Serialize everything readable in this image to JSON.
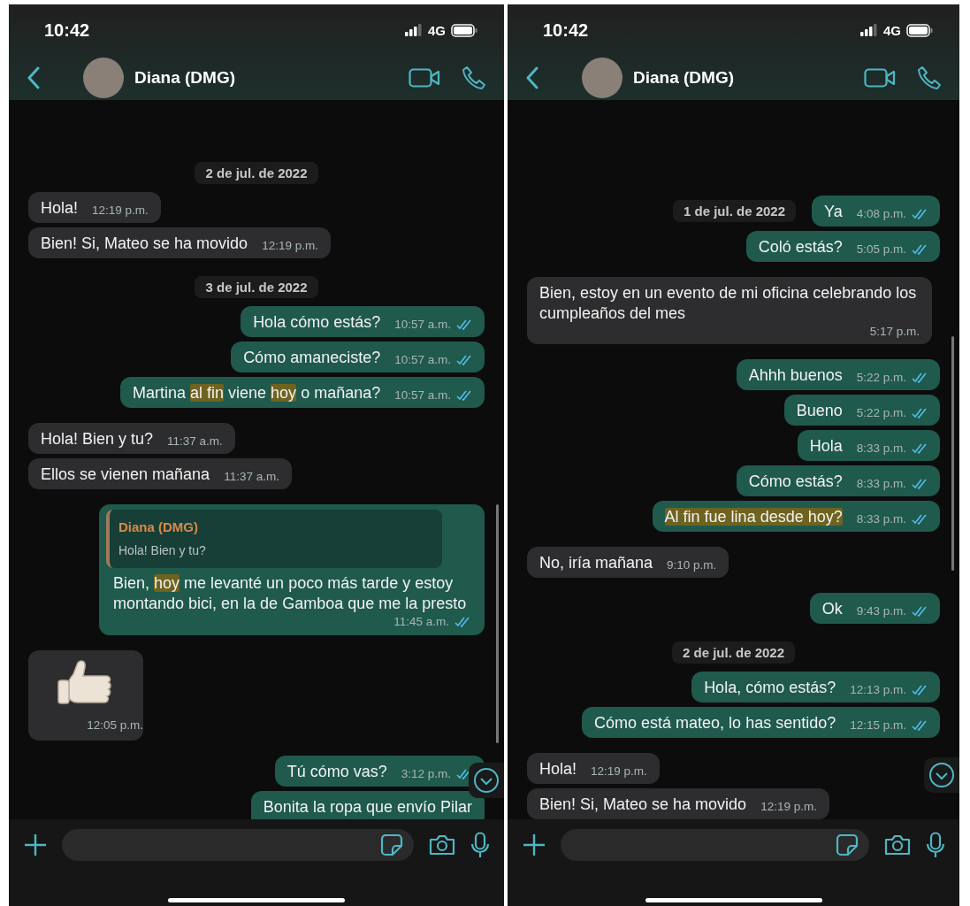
{
  "phones": [
    {
      "status_bar": {
        "time": "10:42",
        "network": "4G"
      },
      "header": {
        "contact": "Diana (DMG)"
      },
      "items": [
        {
          "kind": "date",
          "text": "2 de jul. de 2022"
        },
        {
          "kind": "message",
          "outgoing": false,
          "parts": [
            {
              "text": "Hola!",
              "highlight": false
            }
          ],
          "time": "12:19 p.m."
        },
        {
          "kind": "message",
          "outgoing": false,
          "parts": [
            {
              "text": "Bien! Si, Mateo se ha movido",
              "highlight": false
            }
          ],
          "time": "12:19 p.m."
        },
        {
          "kind": "date",
          "text": "3 de jul. de 2022"
        },
        {
          "kind": "message",
          "outgoing": true,
          "parts": [
            {
              "text": "Hola cómo estás?",
              "highlight": false
            }
          ],
          "time": "10:57 a.m.",
          "read": true
        },
        {
          "kind": "message",
          "outgoing": true,
          "parts": [
            {
              "text": "Cómo amaneciste?",
              "highlight": false
            }
          ],
          "time": "10:57 a.m.",
          "read": true
        },
        {
          "kind": "message",
          "outgoing": true,
          "parts": [
            {
              "text": "Martina ",
              "highlight": false
            },
            {
              "text": "al fin",
              "highlight": true
            },
            {
              "text": " viene ",
              "highlight": false
            },
            {
              "text": "hoy",
              "highlight": true
            },
            {
              "text": " o mañana?",
              "highlight": false
            }
          ],
          "time": "10:57 a.m.",
          "read": true
        },
        {
          "kind": "message",
          "outgoing": false,
          "parts": [
            {
              "text": "Hola! Bien y tu?",
              "highlight": false
            }
          ],
          "time": "11:37 a.m."
        },
        {
          "kind": "message",
          "outgoing": false,
          "parts": [
            {
              "text": "Ellos se vienen mañana",
              "highlight": false
            }
          ],
          "time": "11:37 a.m."
        },
        {
          "kind": "reply",
          "outgoing": true,
          "quote": {
            "author": "Diana (DMG)",
            "text": "Hola! Bien y tu?"
          },
          "parts": [
            {
              "text": "Bien, ",
              "highlight": false
            },
            {
              "text": "hoy",
              "highlight": true
            },
            {
              "text": " me levanté un poco más tarde y estoy montando bici, en la de Gamboa que me la presto",
              "highlight": false
            }
          ],
          "time": "11:45 a.m.",
          "read": true
        },
        {
          "kind": "sticker",
          "outgoing": false,
          "time": "12:05 p.m."
        },
        {
          "kind": "message",
          "outgoing": true,
          "parts": [
            {
              "text": "Tú cómo vas?",
              "highlight": false
            }
          ],
          "time": "3:12 p.m.",
          "read": true
        },
        {
          "kind": "partial",
          "outgoing": true,
          "parts": [
            {
              "text": "Bonita la ropa que envío Pilar",
              "highlight": false
            }
          ]
        }
      ]
    },
    {
      "status_bar": {
        "time": "10:42",
        "network": "4G"
      },
      "header": {
        "contact": "Diana (DMG)"
      },
      "items": [
        {
          "kind": "dated",
          "date": "1 de jul. de 2022",
          "outgoing": true,
          "parts": [
            {
              "text": "Ya",
              "highlight": false
            }
          ],
          "time": "4:08 p.m.",
          "read": true
        },
        {
          "kind": "message",
          "outgoing": true,
          "parts": [
            {
              "text": "Coló estás?",
              "highlight": false
            }
          ],
          "time": "5:05 p.m.",
          "read": true
        },
        {
          "kind": "message",
          "outgoing": false,
          "parts": [
            {
              "text": "Bien, estoy en un evento de mi oficina celebrando los cumpleaños del mes",
              "highlight": false
            }
          ],
          "time": "5:17 p.m."
        },
        {
          "kind": "message",
          "outgoing": true,
          "parts": [
            {
              "text": "Ahhh buenos",
              "highlight": false
            }
          ],
          "time": "5:22 p.m.",
          "read": true
        },
        {
          "kind": "message",
          "outgoing": true,
          "parts": [
            {
              "text": "Bueno",
              "highlight": false
            }
          ],
          "time": "5:22 p.m.",
          "read": true
        },
        {
          "kind": "message",
          "outgoing": true,
          "parts": [
            {
              "text": "Hola",
              "highlight": false
            }
          ],
          "time": "8:33 p.m.",
          "read": true
        },
        {
          "kind": "message",
          "outgoing": true,
          "parts": [
            {
              "text": "Cómo estás?",
              "highlight": false
            }
          ],
          "time": "8:33 p.m.",
          "read": true
        },
        {
          "kind": "message",
          "outgoing": true,
          "parts": [
            {
              "text": "Al fin fue lina desde hoy?",
              "highlight": true
            }
          ],
          "time": "8:33 p.m.",
          "read": true
        },
        {
          "kind": "message",
          "outgoing": false,
          "parts": [
            {
              "text": "No, iría mañana",
              "highlight": false
            }
          ],
          "time": "9:10 p.m."
        },
        {
          "kind": "message",
          "outgoing": true,
          "parts": [
            {
              "text": "Ok",
              "highlight": false
            }
          ],
          "time": "9:43 p.m.",
          "read": true
        },
        {
          "kind": "date",
          "text": "2 de jul. de 2022"
        },
        {
          "kind": "message",
          "outgoing": true,
          "parts": [
            {
              "text": "Hola, cómo estás?",
              "highlight": false
            }
          ],
          "time": "12:13 p.m.",
          "read": true
        },
        {
          "kind": "message",
          "outgoing": true,
          "parts": [
            {
              "text": "Cómo está mateo, lo has sentido?",
              "highlight": false
            }
          ],
          "time": "12:15 p.m.",
          "read": true
        },
        {
          "kind": "message",
          "outgoing": false,
          "parts": [
            {
              "text": "Hola!",
              "highlight": false
            }
          ],
          "time": "12:19 p.m."
        },
        {
          "kind": "message",
          "outgoing": false,
          "parts": [
            {
              "text": "Bien! Si, Mateo se ha movido",
              "highlight": false
            }
          ],
          "time": "12:19 p.m."
        }
      ]
    }
  ]
}
